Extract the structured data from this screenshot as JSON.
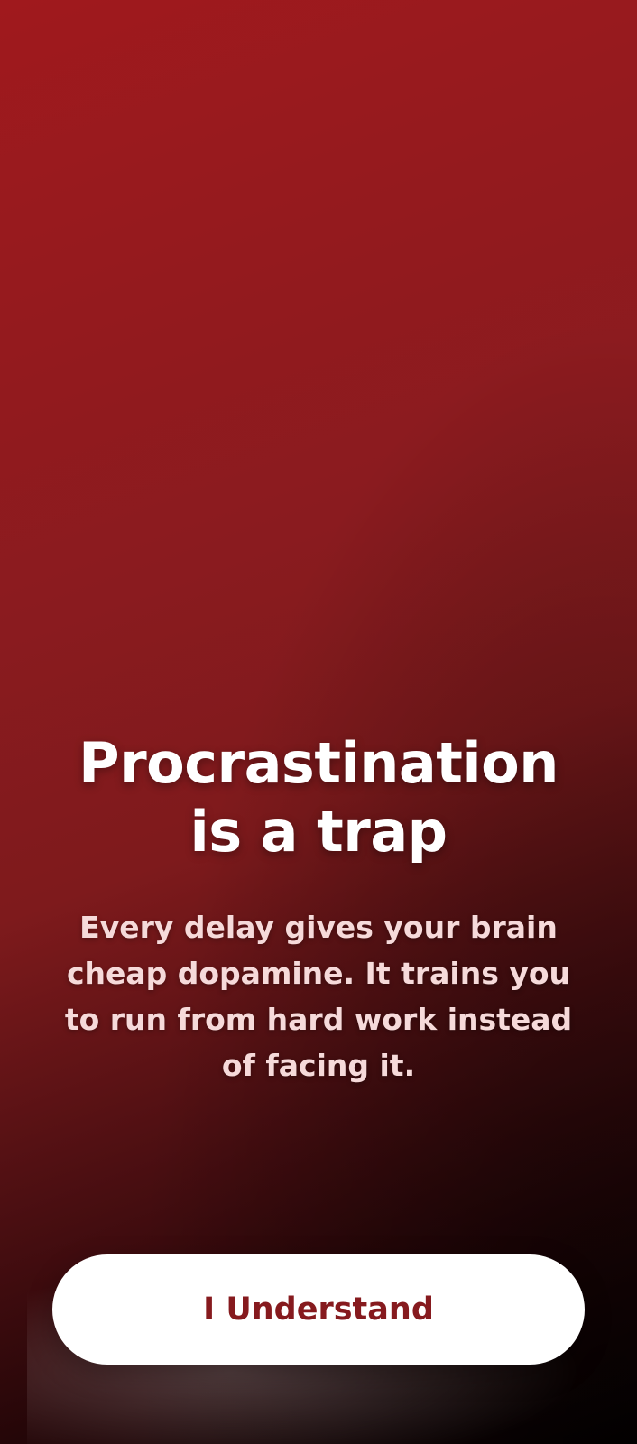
{
  "screen": {
    "title_line_1": "Procrastination",
    "title_line_2": "is a trap",
    "body": "Every delay gives your brain cheap dopamine. It trains you to run from hard work instead of facing it.",
    "button_label": "I Understand"
  },
  "colors": {
    "background_top": "#a0191d",
    "background_bottom": "#050101",
    "button_background": "#ffffff",
    "button_text": "#861a1e",
    "body_text": "#f6dada"
  }
}
